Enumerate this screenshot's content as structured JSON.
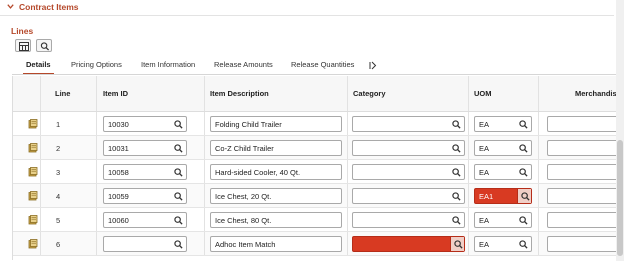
{
  "section": {
    "title": "Contract Items",
    "icon": "chevron-down-icon"
  },
  "lines": {
    "title": "Lines",
    "toolbar": [
      {
        "name": "grid-view-button",
        "icon": "grid-icon"
      },
      {
        "name": "find-button",
        "icon": "search-icon"
      }
    ]
  },
  "tabs": [
    {
      "label": "Details",
      "active": true
    },
    {
      "label": "Pricing Options",
      "active": false
    },
    {
      "label": "Item Information",
      "active": false
    },
    {
      "label": "Release Amounts",
      "active": false
    },
    {
      "label": "Release Quantities",
      "active": false
    }
  ],
  "tabs_more_icon": "show-all-columns-icon",
  "columns": {
    "line": "Line",
    "item_id": "Item ID",
    "item_description": "Item Description",
    "category": "Category",
    "uom": "UOM",
    "merchandise": "Merchandise"
  },
  "rows": [
    {
      "line": "1",
      "item_id": "10030",
      "description": "Folding Child Trailer",
      "category": "",
      "uom": "EA",
      "category_error": false,
      "uom_error": false
    },
    {
      "line": "2",
      "item_id": "10031",
      "description": "Co-Z Child Trailer",
      "category": "",
      "uom": "EA",
      "category_error": false,
      "uom_error": false
    },
    {
      "line": "3",
      "item_id": "10058",
      "description": "Hard-sided Cooler, 40 Qt.",
      "category": "",
      "uom": "EA",
      "category_error": false,
      "uom_error": false
    },
    {
      "line": "4",
      "item_id": "10059",
      "description": "Ice Chest, 20 Qt.",
      "category": "",
      "uom": "EA1",
      "category_error": false,
      "uom_error": true
    },
    {
      "line": "5",
      "item_id": "10060",
      "description": "Ice Chest, 80 Qt.",
      "category": "",
      "uom": "EA",
      "category_error": false,
      "uom_error": false
    },
    {
      "line": "6",
      "item_id": "",
      "description": "Adhoc Item Match",
      "category": "",
      "uom": "EA",
      "category_error": true,
      "uom_error": false
    }
  ],
  "colors": {
    "accent": "#b5482a",
    "error": "#d83a22"
  }
}
